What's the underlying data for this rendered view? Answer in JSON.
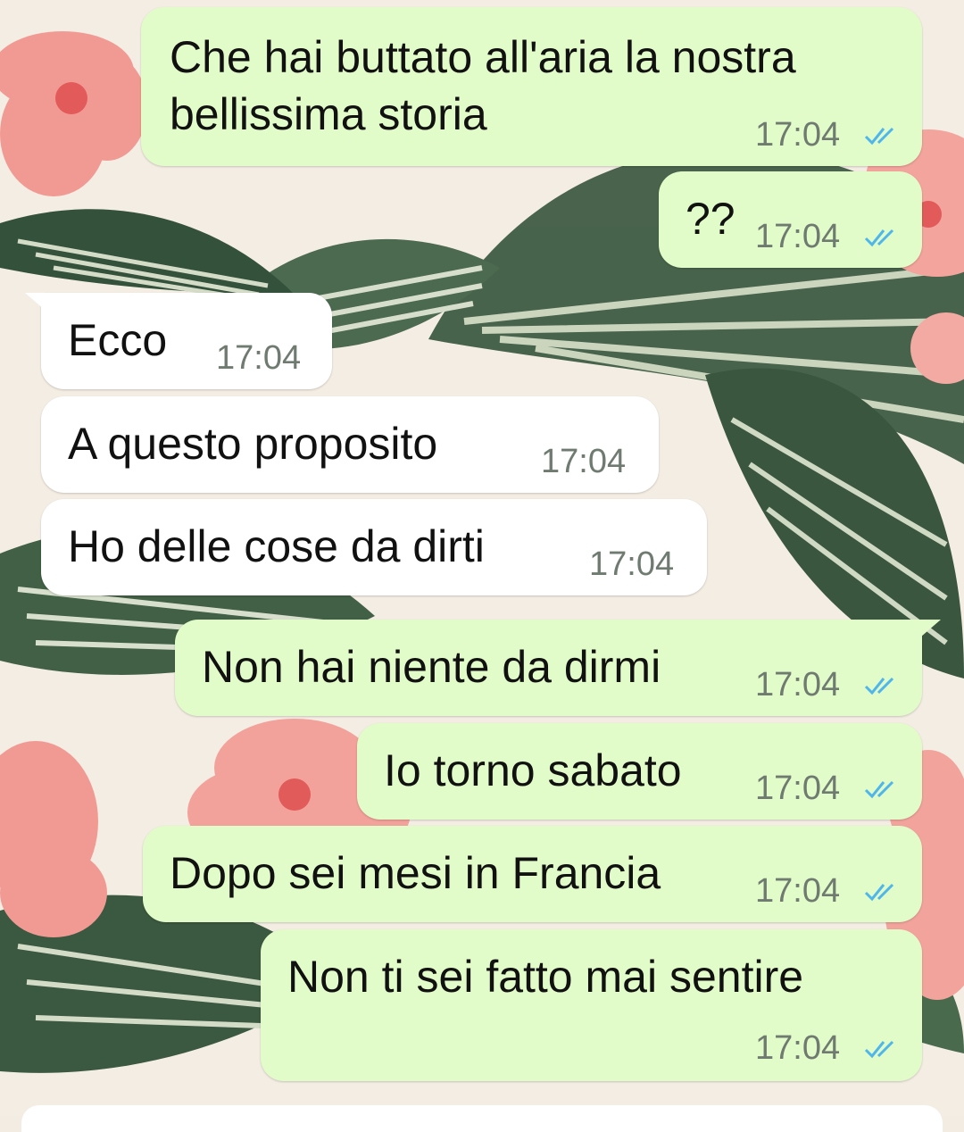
{
  "messages": [
    {
      "id": "m1",
      "direction": "outgoing",
      "text": "Che hai buttato all'aria la nostra\nbellissima storia",
      "time": "17:04",
      "status": "read"
    },
    {
      "id": "m2",
      "direction": "outgoing",
      "text": "??",
      "time": "17:04",
      "status": "read"
    },
    {
      "id": "m3",
      "direction": "incoming",
      "text": "Ecco",
      "time": "17:04"
    },
    {
      "id": "m4",
      "direction": "incoming",
      "text": "A questo proposito",
      "time": "17:04"
    },
    {
      "id": "m5",
      "direction": "incoming",
      "text": "Ho delle cose da dirti",
      "time": "17:04"
    },
    {
      "id": "m6",
      "direction": "outgoing",
      "text": "Non hai niente da dirmi",
      "time": "17:04",
      "status": "read"
    },
    {
      "id": "m7",
      "direction": "outgoing",
      "text": "Io torno sabato",
      "time": "17:04",
      "status": "read"
    },
    {
      "id": "m8",
      "direction": "outgoing",
      "text": "Dopo sei mesi in Francia",
      "time": "17:04",
      "status": "read"
    },
    {
      "id": "m9",
      "direction": "outgoing",
      "text": "Non ti sei fatto mai sentire",
      "time": "17:04",
      "status": "read"
    }
  ],
  "colors": {
    "outgoing_bubble": "#e2fcc9",
    "incoming_bubble": "#ffffff",
    "read_ticks": "#4fb6ec",
    "timestamp": "#6f7a71"
  },
  "icons": {
    "read_status": "double-check-icon"
  }
}
